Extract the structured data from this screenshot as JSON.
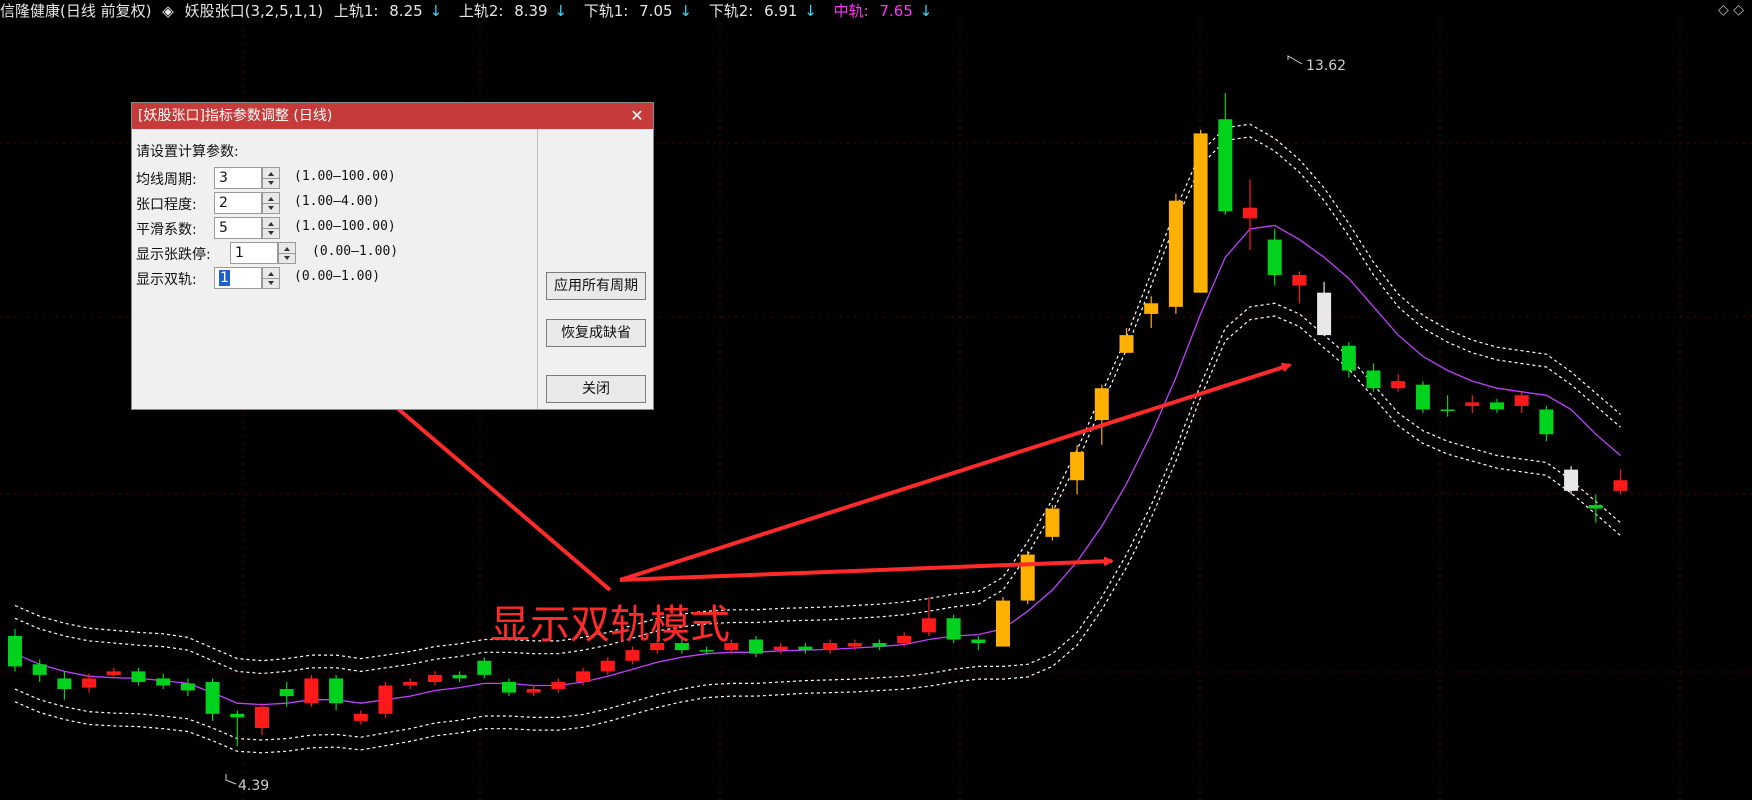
{
  "header": {
    "stock": "信隆健康(日线 前复权)",
    "indicator_icon": "◈",
    "indicator": "妖股张口(3,2,5,1,1)",
    "items": [
      {
        "label": "上轨1:",
        "value": "8.25",
        "arrow": "↓"
      },
      {
        "label": "上轨2:",
        "value": "8.39",
        "arrow": "↓"
      },
      {
        "label": "下轨1:",
        "value": "7.05",
        "arrow": "↓"
      },
      {
        "label": "下轨2:",
        "value": "6.91",
        "arrow": "↓"
      }
    ],
    "mid": {
      "label": "中轨:",
      "value": "7.65",
      "arrow": "↓"
    }
  },
  "top_right_icons": "◇ ◇",
  "dialog": {
    "title": "[妖股张口]指标参数调整 (日线)",
    "close": "✕",
    "prompt": "请设置计算参数:",
    "params": [
      {
        "label": "均线周期:",
        "value": "3",
        "range": "(1.00—100.00)"
      },
      {
        "label": "张口程度:",
        "value": "2",
        "range": "(1.00—4.00)"
      },
      {
        "label": "平滑系数:",
        "value": "5",
        "range": "(1.00—100.00)"
      },
      {
        "label": "显示张跌停:",
        "value": "1",
        "range": "(0.00—1.00)"
      },
      {
        "label": "显示双轨:",
        "value": "1",
        "range": "(0.00—1.00)"
      }
    ],
    "buttons": {
      "apply_all": "应用所有周期",
      "restore": "恢复成缺省",
      "close": "关闭"
    }
  },
  "annotation": "显示双轨模式",
  "chart_labels": {
    "high": "13.62",
    "low": "4.39"
  },
  "colors": {
    "up": "#ff1a1a",
    "down": "#00d21e",
    "limit": "#ffb000",
    "neutral": "#e8e8e8",
    "mid": "#c040ff",
    "band": "#ffffff",
    "annotation": "#ff2a2a"
  },
  "chart_data": {
    "type": "candlestick",
    "price_range": [
      4.0,
      14.2
    ],
    "candles": [
      {
        "o": 5.95,
        "c": 5.52,
        "h": 6.05,
        "l": 5.45,
        "k": "down"
      },
      {
        "o": 5.55,
        "c": 5.4,
        "h": 5.62,
        "l": 5.3,
        "k": "down"
      },
      {
        "o": 5.35,
        "c": 5.2,
        "h": 5.45,
        "l": 5.05,
        "k": "down"
      },
      {
        "o": 5.22,
        "c": 5.35,
        "h": 5.42,
        "l": 5.15,
        "k": "up"
      },
      {
        "o": 5.4,
        "c": 5.45,
        "h": 5.5,
        "l": 5.35,
        "k": "up"
      },
      {
        "o": 5.45,
        "c": 5.3,
        "h": 5.5,
        "l": 5.25,
        "k": "down"
      },
      {
        "o": 5.35,
        "c": 5.25,
        "h": 5.42,
        "l": 5.2,
        "k": "down"
      },
      {
        "o": 5.28,
        "c": 5.18,
        "h": 5.35,
        "l": 5.1,
        "k": "down"
      },
      {
        "o": 5.3,
        "c": 4.85,
        "h": 5.35,
        "l": 4.75,
        "k": "down"
      },
      {
        "o": 4.85,
        "c": 4.8,
        "h": 4.9,
        "l": 4.39,
        "k": "down"
      },
      {
        "o": 4.65,
        "c": 4.95,
        "h": 5.0,
        "l": 4.55,
        "k": "up"
      },
      {
        "o": 5.1,
        "c": 5.2,
        "h": 5.3,
        "l": 4.95,
        "k": "down"
      },
      {
        "o": 5.0,
        "c": 5.35,
        "h": 5.4,
        "l": 4.95,
        "k": "up"
      },
      {
        "o": 5.35,
        "c": 5.0,
        "h": 5.4,
        "l": 4.9,
        "k": "down"
      },
      {
        "o": 4.75,
        "c": 4.85,
        "h": 4.9,
        "l": 4.7,
        "k": "up"
      },
      {
        "o": 4.85,
        "c": 5.25,
        "h": 5.3,
        "l": 4.8,
        "k": "up"
      },
      {
        "o": 5.25,
        "c": 5.3,
        "h": 5.35,
        "l": 5.2,
        "k": "up"
      },
      {
        "o": 5.3,
        "c": 5.4,
        "h": 5.45,
        "l": 5.25,
        "k": "up"
      },
      {
        "o": 5.4,
        "c": 5.35,
        "h": 5.45,
        "l": 5.3,
        "k": "down"
      },
      {
        "o": 5.4,
        "c": 5.6,
        "h": 5.65,
        "l": 5.35,
        "k": "down"
      },
      {
        "o": 5.3,
        "c": 5.15,
        "h": 5.35,
        "l": 5.1,
        "k": "down"
      },
      {
        "o": 5.15,
        "c": 5.2,
        "h": 5.25,
        "l": 5.1,
        "k": "up"
      },
      {
        "o": 5.2,
        "c": 5.3,
        "h": 5.35,
        "l": 5.15,
        "k": "up"
      },
      {
        "o": 5.3,
        "c": 5.45,
        "h": 5.5,
        "l": 5.25,
        "k": "up"
      },
      {
        "o": 5.45,
        "c": 5.6,
        "h": 5.65,
        "l": 5.4,
        "k": "up"
      },
      {
        "o": 5.6,
        "c": 5.75,
        "h": 5.8,
        "l": 5.55,
        "k": "up"
      },
      {
        "o": 5.75,
        "c": 5.85,
        "h": 5.9,
        "l": 5.7,
        "k": "up"
      },
      {
        "o": 5.85,
        "c": 5.75,
        "h": 5.9,
        "l": 5.7,
        "k": "down"
      },
      {
        "o": 5.75,
        "c": 5.75,
        "h": 5.8,
        "l": 5.7,
        "k": "down"
      },
      {
        "o": 5.75,
        "c": 5.85,
        "h": 5.9,
        "l": 5.7,
        "k": "up"
      },
      {
        "o": 5.9,
        "c": 5.7,
        "h": 5.95,
        "l": 5.65,
        "k": "down"
      },
      {
        "o": 5.75,
        "c": 5.8,
        "h": 5.85,
        "l": 5.7,
        "k": "up"
      },
      {
        "o": 5.8,
        "c": 5.75,
        "h": 5.85,
        "l": 5.7,
        "k": "down"
      },
      {
        "o": 5.75,
        "c": 5.85,
        "h": 5.9,
        "l": 5.7,
        "k": "up"
      },
      {
        "o": 5.85,
        "c": 5.8,
        "h": 5.9,
        "l": 5.75,
        "k": "up"
      },
      {
        "o": 5.8,
        "c": 5.85,
        "h": 5.9,
        "l": 5.75,
        "k": "down"
      },
      {
        "o": 5.85,
        "c": 5.95,
        "h": 6.0,
        "l": 5.8,
        "k": "up"
      },
      {
        "o": 6.0,
        "c": 6.2,
        "h": 6.5,
        "l": 5.95,
        "k": "up"
      },
      {
        "o": 6.2,
        "c": 5.9,
        "h": 6.25,
        "l": 5.85,
        "k": "down"
      },
      {
        "o": 5.85,
        "c": 5.9,
        "h": 5.95,
        "l": 5.75,
        "k": "down"
      },
      {
        "o": 5.8,
        "c": 6.45,
        "h": 6.5,
        "l": 5.8,
        "k": "limit"
      },
      {
        "o": 6.45,
        "c": 7.1,
        "h": 7.15,
        "l": 6.4,
        "k": "limit"
      },
      {
        "o": 7.35,
        "c": 7.75,
        "h": 7.8,
        "l": 7.3,
        "k": "limit"
      },
      {
        "o": 8.15,
        "c": 8.55,
        "h": 8.65,
        "l": 7.95,
        "k": "limit"
      },
      {
        "o": 9.0,
        "c": 9.45,
        "h": 9.5,
        "l": 8.65,
        "k": "limit"
      },
      {
        "o": 9.95,
        "c": 10.2,
        "h": 10.3,
        "l": 9.95,
        "k": "limit"
      },
      {
        "o": 10.5,
        "c": 10.65,
        "h": 10.75,
        "l": 10.3,
        "k": "limit"
      },
      {
        "o": 10.6,
        "c": 12.1,
        "h": 12.2,
        "l": 10.5,
        "k": "limit"
      },
      {
        "o": 10.8,
        "c": 13.05,
        "h": 13.1,
        "l": 10.8,
        "k": "limit"
      },
      {
        "o": 13.25,
        "c": 11.95,
        "h": 13.62,
        "l": 11.9,
        "k": "down"
      },
      {
        "o": 12.0,
        "c": 11.85,
        "h": 12.4,
        "l": 11.4,
        "k": "up"
      },
      {
        "o": 11.55,
        "c": 11.05,
        "h": 11.7,
        "l": 10.9,
        "k": "down"
      },
      {
        "o": 11.05,
        "c": 10.9,
        "h": 11.1,
        "l": 10.65,
        "k": "up"
      },
      {
        "o": 10.8,
        "c": 10.2,
        "h": 10.95,
        "l": 10.2,
        "k": "neutral"
      },
      {
        "o": 10.05,
        "c": 9.7,
        "h": 10.1,
        "l": 9.6,
        "k": "down"
      },
      {
        "o": 9.7,
        "c": 9.45,
        "h": 9.8,
        "l": 9.4,
        "k": "down"
      },
      {
        "o": 9.55,
        "c": 9.45,
        "h": 9.65,
        "l": 9.4,
        "k": "up"
      },
      {
        "o": 9.5,
        "c": 9.15,
        "h": 9.55,
        "l": 9.1,
        "k": "down"
      },
      {
        "o": 9.15,
        "c": 9.15,
        "h": 9.35,
        "l": 9.05,
        "k": "down"
      },
      {
        "o": 9.2,
        "c": 9.25,
        "h": 9.35,
        "l": 9.1,
        "k": "up"
      },
      {
        "o": 9.25,
        "c": 9.15,
        "h": 9.3,
        "l": 9.1,
        "k": "down"
      },
      {
        "o": 9.2,
        "c": 9.35,
        "h": 9.4,
        "l": 9.1,
        "k": "up"
      },
      {
        "o": 9.15,
        "c": 8.8,
        "h": 9.2,
        "l": 8.7,
        "k": "down"
      },
      {
        "o": 8.3,
        "c": 8.0,
        "h": 8.35,
        "l": 7.95,
        "k": "neutral"
      },
      {
        "o": 7.8,
        "c": 7.75,
        "h": 7.95,
        "l": 7.55,
        "k": "down"
      },
      {
        "o": 8.0,
        "c": 8.15,
        "h": 8.3,
        "l": 7.95,
        "k": "up"
      }
    ],
    "mid": [
      5.7,
      5.55,
      5.45,
      5.38,
      5.36,
      5.35,
      5.32,
      5.28,
      5.15,
      5.0,
      4.98,
      5.0,
      5.05,
      5.05,
      5.0,
      5.05,
      5.1,
      5.18,
      5.22,
      5.28,
      5.28,
      5.25,
      5.25,
      5.3,
      5.38,
      5.48,
      5.58,
      5.65,
      5.7,
      5.72,
      5.72,
      5.74,
      5.75,
      5.76,
      5.78,
      5.8,
      5.83,
      5.9,
      5.95,
      5.97,
      6.05,
      6.3,
      6.6,
      7.0,
      7.5,
      8.1,
      8.8,
      9.6,
      10.5,
      11.3,
      11.7,
      11.75,
      11.55,
      11.3,
      11.0,
      10.6,
      10.2,
      9.9,
      9.7,
      9.55,
      9.45,
      9.4,
      9.35,
      9.15,
      8.8,
      8.5
    ],
    "upper": [
      6.2,
      6.05,
      5.95,
      5.88,
      5.85,
      5.82,
      5.8,
      5.75,
      5.6,
      5.45,
      5.42,
      5.45,
      5.5,
      5.5,
      5.45,
      5.5,
      5.55,
      5.62,
      5.66,
      5.72,
      5.72,
      5.7,
      5.7,
      5.75,
      5.82,
      5.92,
      6.02,
      6.08,
      6.12,
      6.14,
      6.14,
      6.16,
      6.17,
      6.18,
      6.2,
      6.22,
      6.25,
      6.3,
      6.36,
      6.4,
      6.6,
      7.1,
      7.7,
      8.4,
      9.2,
      10.0,
      10.9,
      11.8,
      12.6,
      12.95,
      13.0,
      12.8,
      12.5,
      12.1,
      11.6,
      11.05,
      10.6,
      10.3,
      10.1,
      9.95,
      9.85,
      9.8,
      9.75,
      9.5,
      9.2,
      8.9
    ],
    "lower": [
      5.2,
      5.05,
      4.95,
      4.88,
      4.86,
      4.85,
      4.82,
      4.78,
      4.65,
      4.5,
      4.48,
      4.5,
      4.55,
      4.56,
      4.52,
      4.58,
      4.64,
      4.72,
      4.76,
      4.82,
      4.82,
      4.8,
      4.8,
      4.84,
      4.92,
      5.02,
      5.12,
      5.2,
      5.26,
      5.28,
      5.28,
      5.3,
      5.32,
      5.33,
      5.34,
      5.36,
      5.38,
      5.42,
      5.48,
      5.52,
      5.52,
      5.55,
      5.7,
      6.0,
      6.5,
      7.1,
      7.8,
      8.6,
      9.5,
      10.3,
      10.6,
      10.65,
      10.5,
      10.2,
      9.9,
      9.5,
      9.1,
      8.85,
      8.7,
      8.6,
      8.5,
      8.45,
      8.4,
      8.15,
      7.85,
      7.55
    ]
  }
}
